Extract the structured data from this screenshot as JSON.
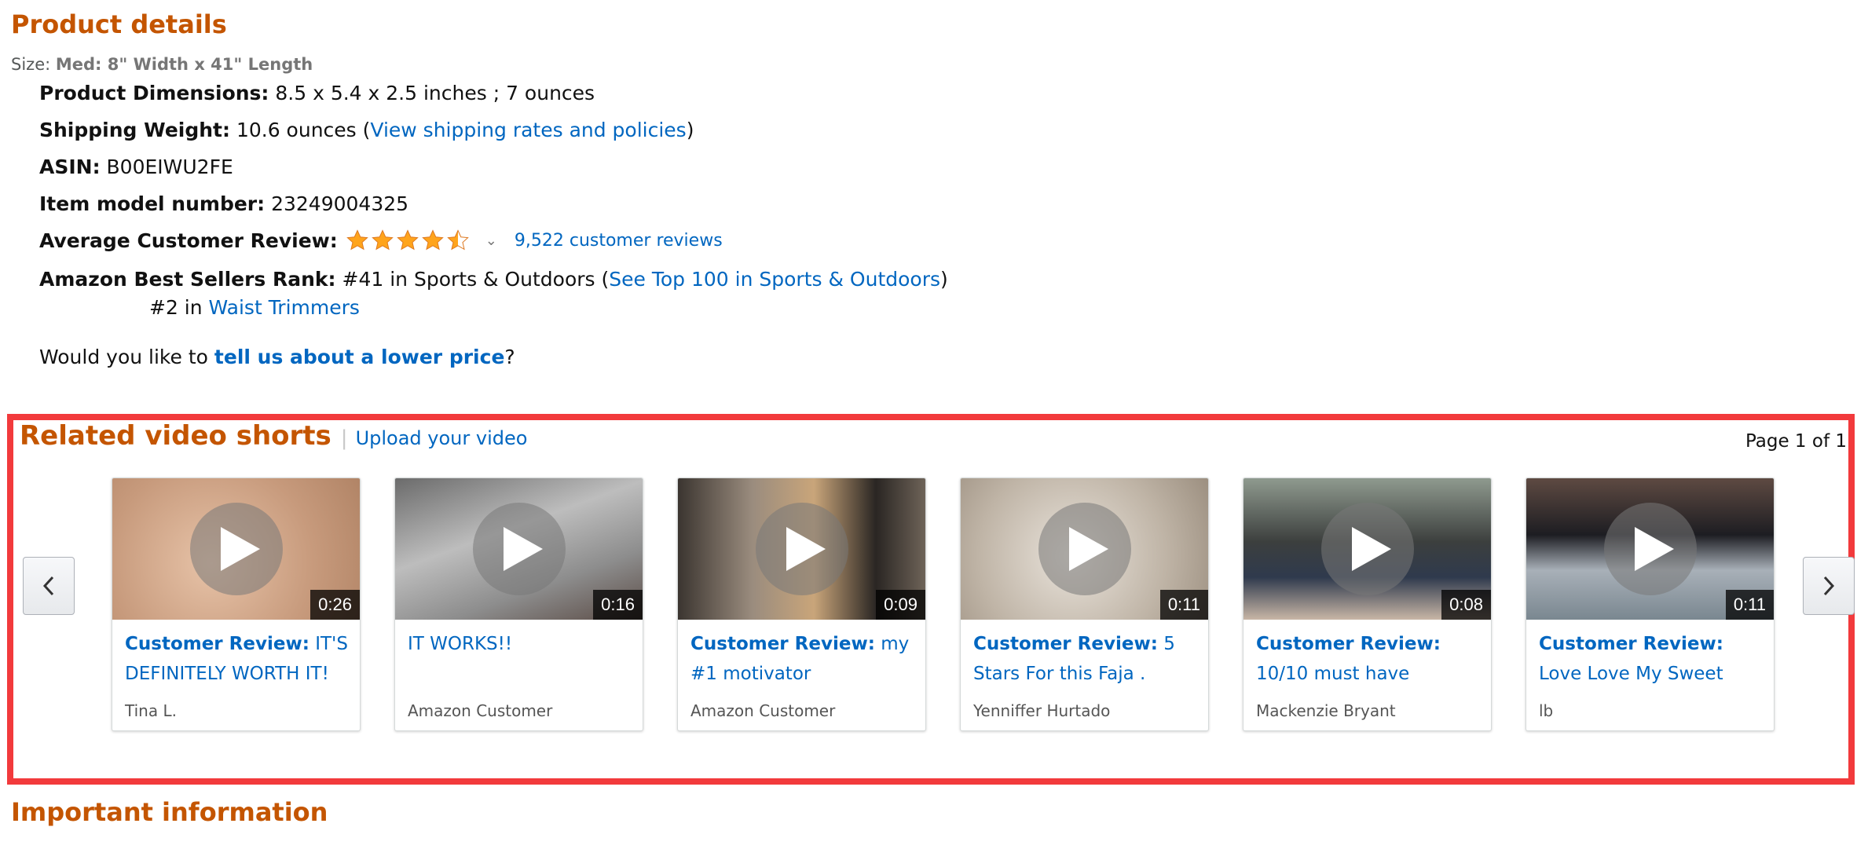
{
  "product_details": {
    "title": "Product details",
    "size_label": "Size:",
    "size_value": "Med: 8\" Width x 41\" Length",
    "dimensions_label": "Product Dimensions:",
    "dimensions_value": "8.5 x 5.4 x 2.5 inches ; 7 ounces",
    "shipping_label": "Shipping Weight:",
    "shipping_value": "10.6 ounces (",
    "shipping_link": "View shipping rates and policies",
    "shipping_close": ")",
    "asin_label": "ASIN:",
    "asin_value": "B00EIWU2FE",
    "model_label": "Item model number:",
    "model_value": "23249004325",
    "review_label": "Average Customer Review:",
    "review_rating": 4.5,
    "review_link": "9,522 customer reviews",
    "rank_label": "Amazon Best Sellers Rank:",
    "rank_value": "#41 in Sports & Outdoors (",
    "rank_link": "See Top 100 in Sports & Outdoors",
    "rank_close": ")",
    "rank2_value": "#2 in",
    "rank2_link": "Waist Trimmers",
    "lower_price_prefix": "Would you like to",
    "lower_price_link": "tell us about a lower price",
    "lower_price_suffix": "?"
  },
  "videos": {
    "title": "Related video shorts",
    "separator": "|",
    "upload_link": "Upload your video",
    "page_indicator": "Page 1 of 1",
    "items": [
      {
        "prefix": "Customer Review:",
        "title": "IT'S DEFINITELY WORTH IT!",
        "author": "Tina L.",
        "duration": "0:26"
      },
      {
        "prefix": "",
        "title": "IT WORKS!!",
        "author": "Amazon Customer",
        "duration": "0:16"
      },
      {
        "prefix": "Customer Review:",
        "title": "my #1 motivator",
        "author": "Amazon Customer",
        "duration": "0:09"
      },
      {
        "prefix": "Customer Review:",
        "title": "5 Stars For this Faja .",
        "author": "Yenniffer Hurtado",
        "duration": "0:11"
      },
      {
        "prefix": "Customer Review:",
        "title": "10/10 must have",
        "author": "Mackenzie Bryant",
        "duration": "0:08"
      },
      {
        "prefix": "Customer Review:",
        "title": "Love Love My Sweet Sweat…",
        "author": "lb",
        "duration": "0:11"
      }
    ]
  },
  "important": {
    "title": "Important information"
  },
  "colors": {
    "accent_orange": "#c45500",
    "link_blue": "#0066c0",
    "highlight_red": "#f23a3c",
    "star_gold": "#ffa41c"
  }
}
